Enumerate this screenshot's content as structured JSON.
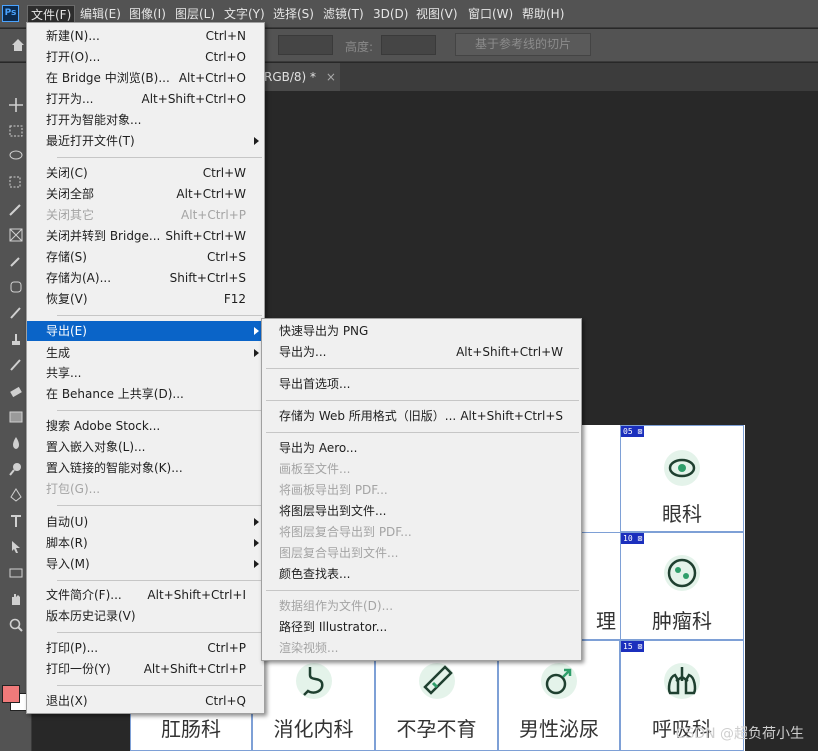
{
  "app": {
    "logo": "Ps"
  },
  "menubar": {
    "items": [
      "文件(F)",
      "编辑(E)",
      "图像(I)",
      "图层(L)",
      "文字(Y)",
      "选择(S)",
      "滤镜(T)",
      "3D(D)",
      "视图(V)",
      "窗口(W)",
      "帮助(H)"
    ]
  },
  "options": {
    "height_label": "高度:",
    "button": "基于参考线的切片"
  },
  "document_tab": {
    "label": "RGB/8) *",
    "close": "×"
  },
  "file_menu": {
    "items": [
      {
        "label": "新建(N)...",
        "shortcut": "Ctrl+N"
      },
      {
        "label": "打开(O)...",
        "shortcut": "Ctrl+O"
      },
      {
        "label": "在 Bridge 中浏览(B)...",
        "shortcut": "Alt+Ctrl+O"
      },
      {
        "label": "打开为...",
        "shortcut": "Alt+Shift+Ctrl+O"
      },
      {
        "label": "打开为智能对象...",
        "shortcut": ""
      },
      {
        "label": "最近打开文件(T)",
        "shortcut": ""
      },
      {
        "label": "关闭(C)",
        "shortcut": "Ctrl+W"
      },
      {
        "label": "关闭全部",
        "shortcut": "Alt+Ctrl+W"
      },
      {
        "label": "关闭其它",
        "shortcut": "Alt+Ctrl+P"
      },
      {
        "label": "关闭并转到 Bridge...",
        "shortcut": "Shift+Ctrl+W"
      },
      {
        "label": "存储(S)",
        "shortcut": "Ctrl+S"
      },
      {
        "label": "存储为(A)...",
        "shortcut": "Shift+Ctrl+S"
      },
      {
        "label": "恢复(V)",
        "shortcut": "F12"
      },
      {
        "label": "导出(E)",
        "shortcut": ""
      },
      {
        "label": "生成",
        "shortcut": ""
      },
      {
        "label": "共享...",
        "shortcut": ""
      },
      {
        "label": "在 Behance 上共享(D)...",
        "shortcut": ""
      },
      {
        "label": "搜索 Adobe Stock...",
        "shortcut": ""
      },
      {
        "label": "置入嵌入对象(L)...",
        "shortcut": ""
      },
      {
        "label": "置入链接的智能对象(K)...",
        "shortcut": ""
      },
      {
        "label": "打包(G)...",
        "shortcut": ""
      },
      {
        "label": "自动(U)",
        "shortcut": ""
      },
      {
        "label": "脚本(R)",
        "shortcut": ""
      },
      {
        "label": "导入(M)",
        "shortcut": ""
      },
      {
        "label": "文件简介(F)...",
        "shortcut": "Alt+Shift+Ctrl+I"
      },
      {
        "label": "版本历史记录(V)",
        "shortcut": ""
      },
      {
        "label": "打印(P)...",
        "shortcut": "Ctrl+P"
      },
      {
        "label": "打印一份(Y)",
        "shortcut": "Alt+Shift+Ctrl+P"
      },
      {
        "label": "退出(X)",
        "shortcut": "Ctrl+Q"
      }
    ]
  },
  "export_menu": {
    "items": [
      {
        "label": "快速导出为 PNG",
        "shortcut": ""
      },
      {
        "label": "导出为...",
        "shortcut": "Alt+Shift+Ctrl+W"
      },
      {
        "label": "导出首选项...",
        "shortcut": ""
      },
      {
        "label": "存储为 Web 所用格式（旧版）...",
        "shortcut": "Alt+Shift+Ctrl+S"
      },
      {
        "label": "导出为 Aero...",
        "shortcut": ""
      },
      {
        "label": "画板至文件...",
        "shortcut": ""
      },
      {
        "label": "将画板导出到 PDF...",
        "shortcut": ""
      },
      {
        "label": "将图层导出到文件...",
        "shortcut": ""
      },
      {
        "label": "将图层复合导出到 PDF...",
        "shortcut": ""
      },
      {
        "label": "图层复合导出到文件...",
        "shortcut": ""
      },
      {
        "label": "颜色查找表...",
        "shortcut": ""
      },
      {
        "label": "数据组作为文件(D)...",
        "shortcut": ""
      },
      {
        "label": "路径到 Illustrator...",
        "shortcut": ""
      },
      {
        "label": "渲染视频...",
        "shortcut": ""
      }
    ]
  },
  "canvas": {
    "cells": [
      {
        "badge": "05",
        "label": "眼科",
        "icon": "eye-icon"
      },
      {
        "badge": "10",
        "label": "肿瘤科",
        "icon": "tumor-icon"
      },
      {
        "badge": "",
        "label": "理",
        "icon": ""
      },
      {
        "badge": "15",
        "label": "呼吸科",
        "icon": "lungs-icon"
      },
      {
        "badge": "",
        "label": "肛肠科",
        "icon": ""
      },
      {
        "badge": "",
        "label": "消化内科",
        "icon": "stomach-icon"
      },
      {
        "badge": "",
        "label": "不孕不育",
        "icon": "test-strip-icon"
      },
      {
        "badge": "",
        "label": "男性泌尿",
        "icon": "male-icon"
      }
    ]
  },
  "colors": {
    "foreground": "#f07a7a",
    "background": "#ffffff",
    "accent": "#0a64c8",
    "icon_green": "#2f9e6a"
  },
  "watermark": {
    "text": "CSDN @超负荷小生"
  }
}
